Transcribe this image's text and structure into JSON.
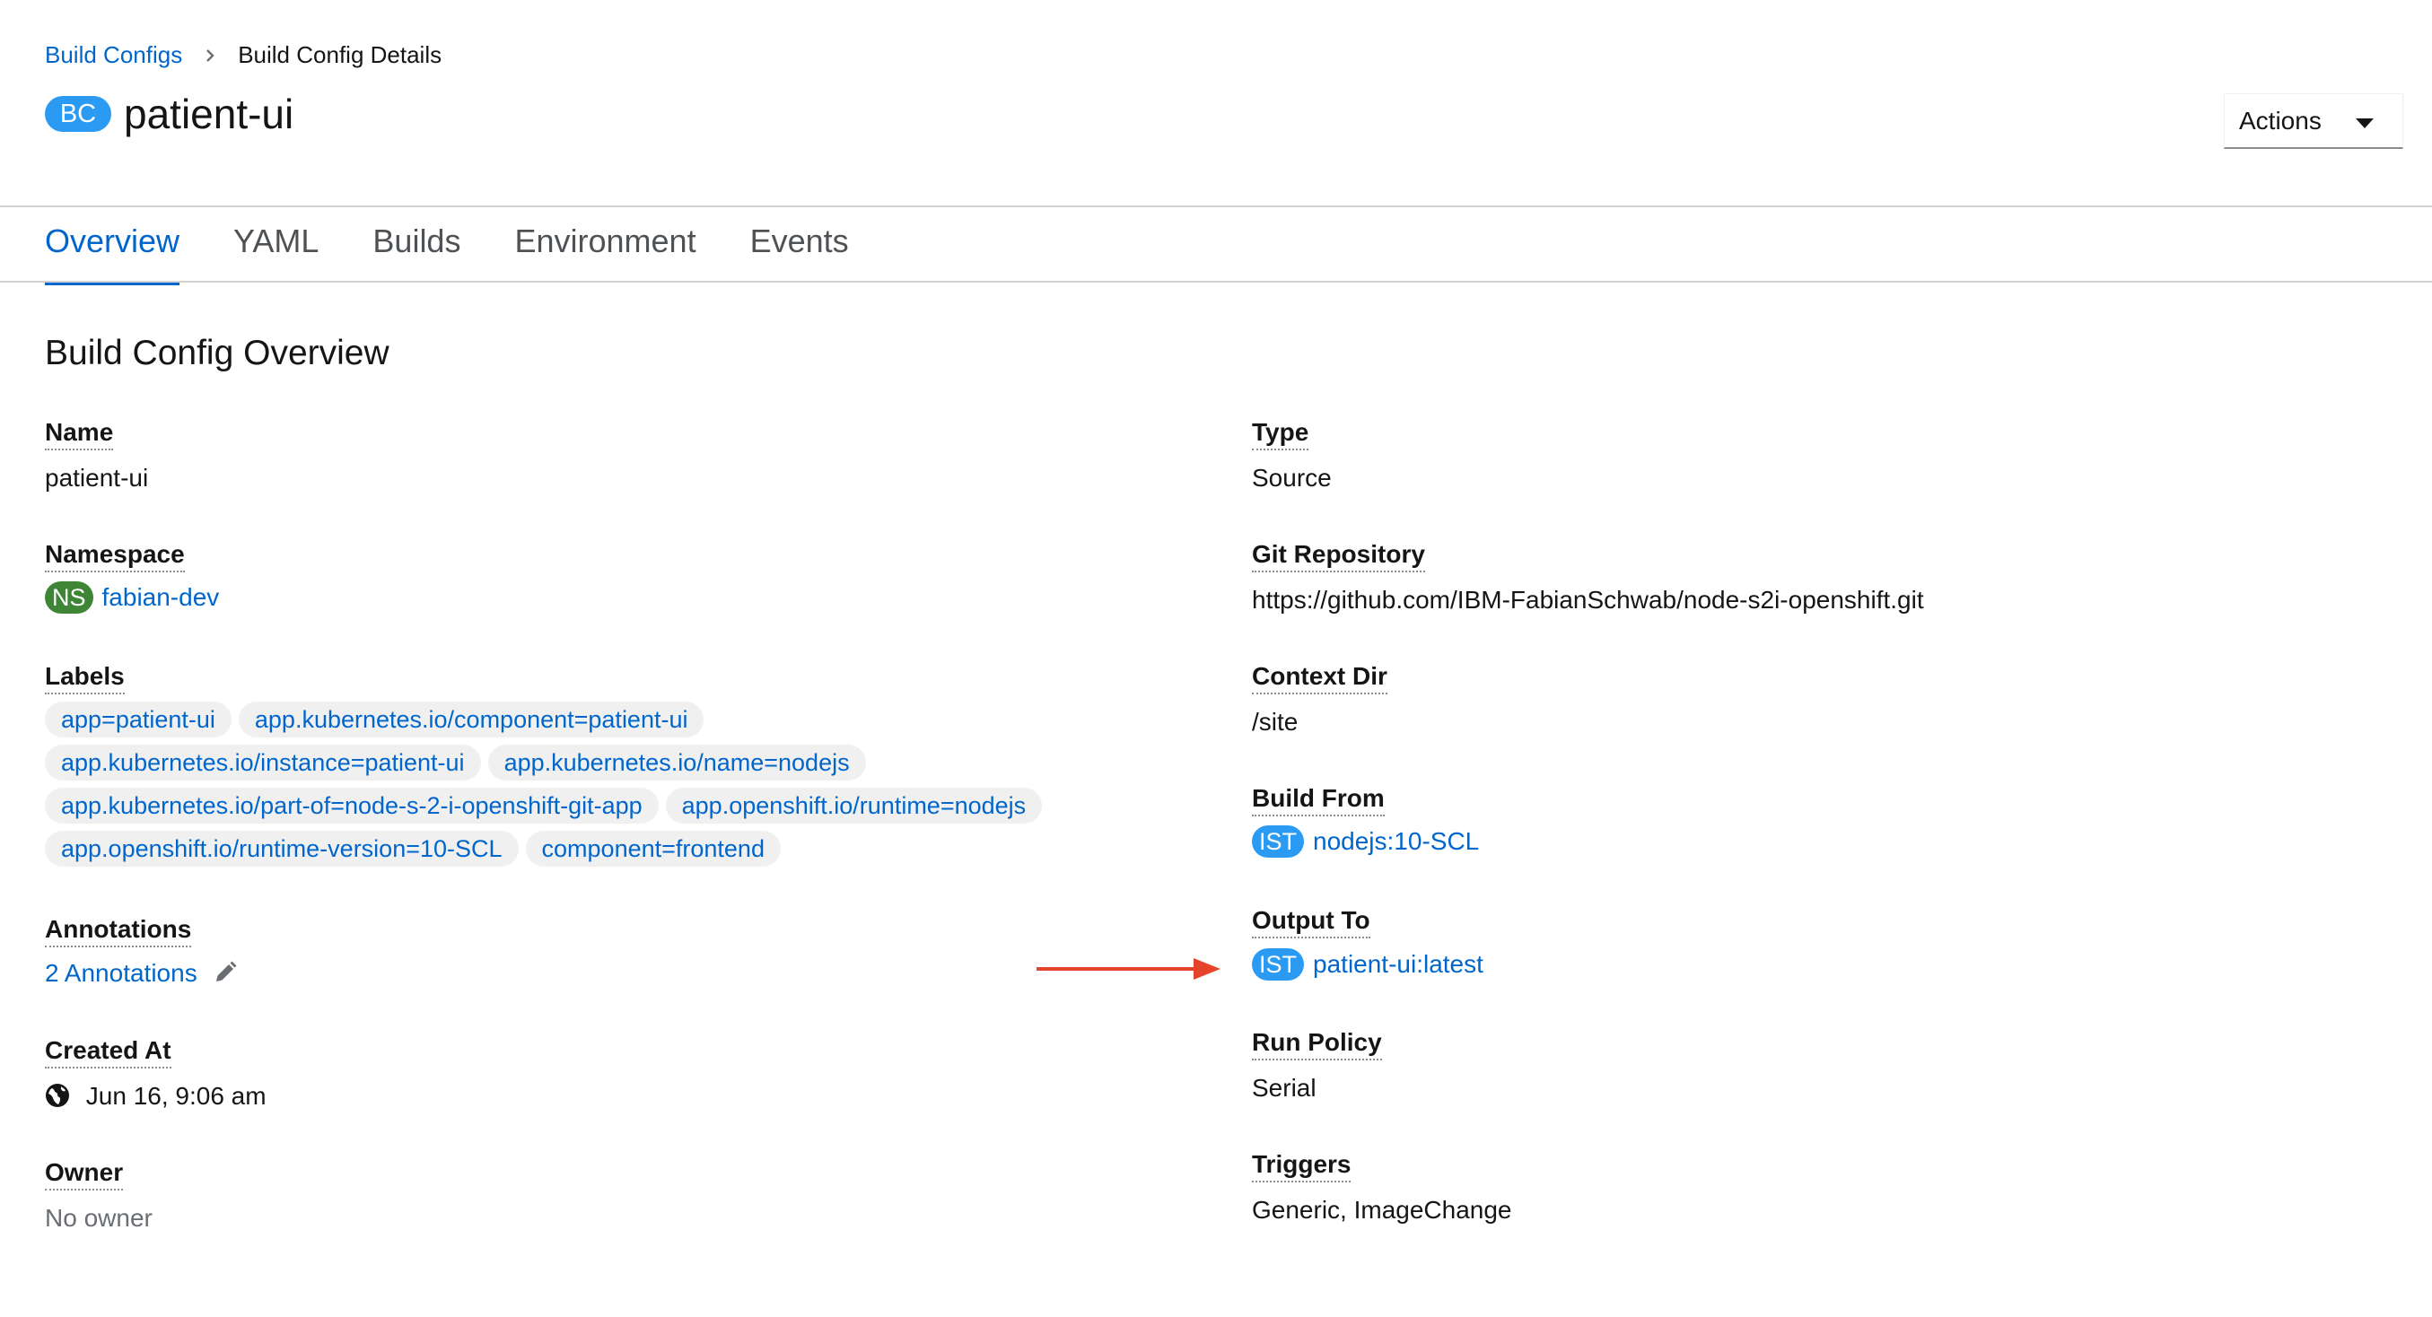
{
  "breadcrumb": {
    "parent": "Build Configs",
    "current": "Build Config Details"
  },
  "header": {
    "badge": "BC",
    "title": "patient-ui",
    "actions_label": "Actions"
  },
  "tabs": [
    {
      "label": "Overview",
      "active": true
    },
    {
      "label": "YAML"
    },
    {
      "label": "Builds"
    },
    {
      "label": "Environment"
    },
    {
      "label": "Events"
    }
  ],
  "section_title": "Build Config Overview",
  "left": {
    "name": {
      "term": "Name",
      "value": "patient-ui"
    },
    "namespace": {
      "term": "Namespace",
      "badge": "NS",
      "value": "fabian-dev"
    },
    "labels": {
      "term": "Labels",
      "rows": [
        [
          "app=patient-ui",
          "app.kubernetes.io/component=patient-ui"
        ],
        [
          "app.kubernetes.io/instance=patient-ui",
          "app.kubernetes.io/name=nodejs"
        ],
        [
          "app.kubernetes.io/part-of=node-s-2-i-openshift-git-app",
          "app.openshift.io/runtime=nodejs"
        ],
        [
          "app.openshift.io/runtime-version=10-SCL",
          "component=frontend"
        ]
      ]
    },
    "annotations": {
      "term": "Annotations",
      "value": "2 Annotations"
    },
    "created_at": {
      "term": "Created At",
      "value": "Jun 16, 9:06 am"
    },
    "owner": {
      "term": "Owner",
      "value": "No owner"
    }
  },
  "right": {
    "type": {
      "term": "Type",
      "value": "Source"
    },
    "git_repository": {
      "term": "Git Repository",
      "value": "https://github.com/IBM-FabianSchwab/node-s2i-openshift.git"
    },
    "context_dir": {
      "term": "Context Dir",
      "value": "/site"
    },
    "build_from": {
      "term": "Build From",
      "badge": "IST",
      "value": "nodejs:10-SCL"
    },
    "output_to": {
      "term": "Output To",
      "badge": "IST",
      "value": "patient-ui:latest"
    },
    "run_policy": {
      "term": "Run Policy",
      "value": "Serial"
    },
    "triggers": {
      "term": "Triggers",
      "value": "Generic, ImageChange"
    }
  },
  "colors": {
    "link": "#0066cc",
    "bc_badge": "#2b9af3",
    "ns_badge": "#3e8635",
    "annotation_arrow": "#e5442b"
  }
}
